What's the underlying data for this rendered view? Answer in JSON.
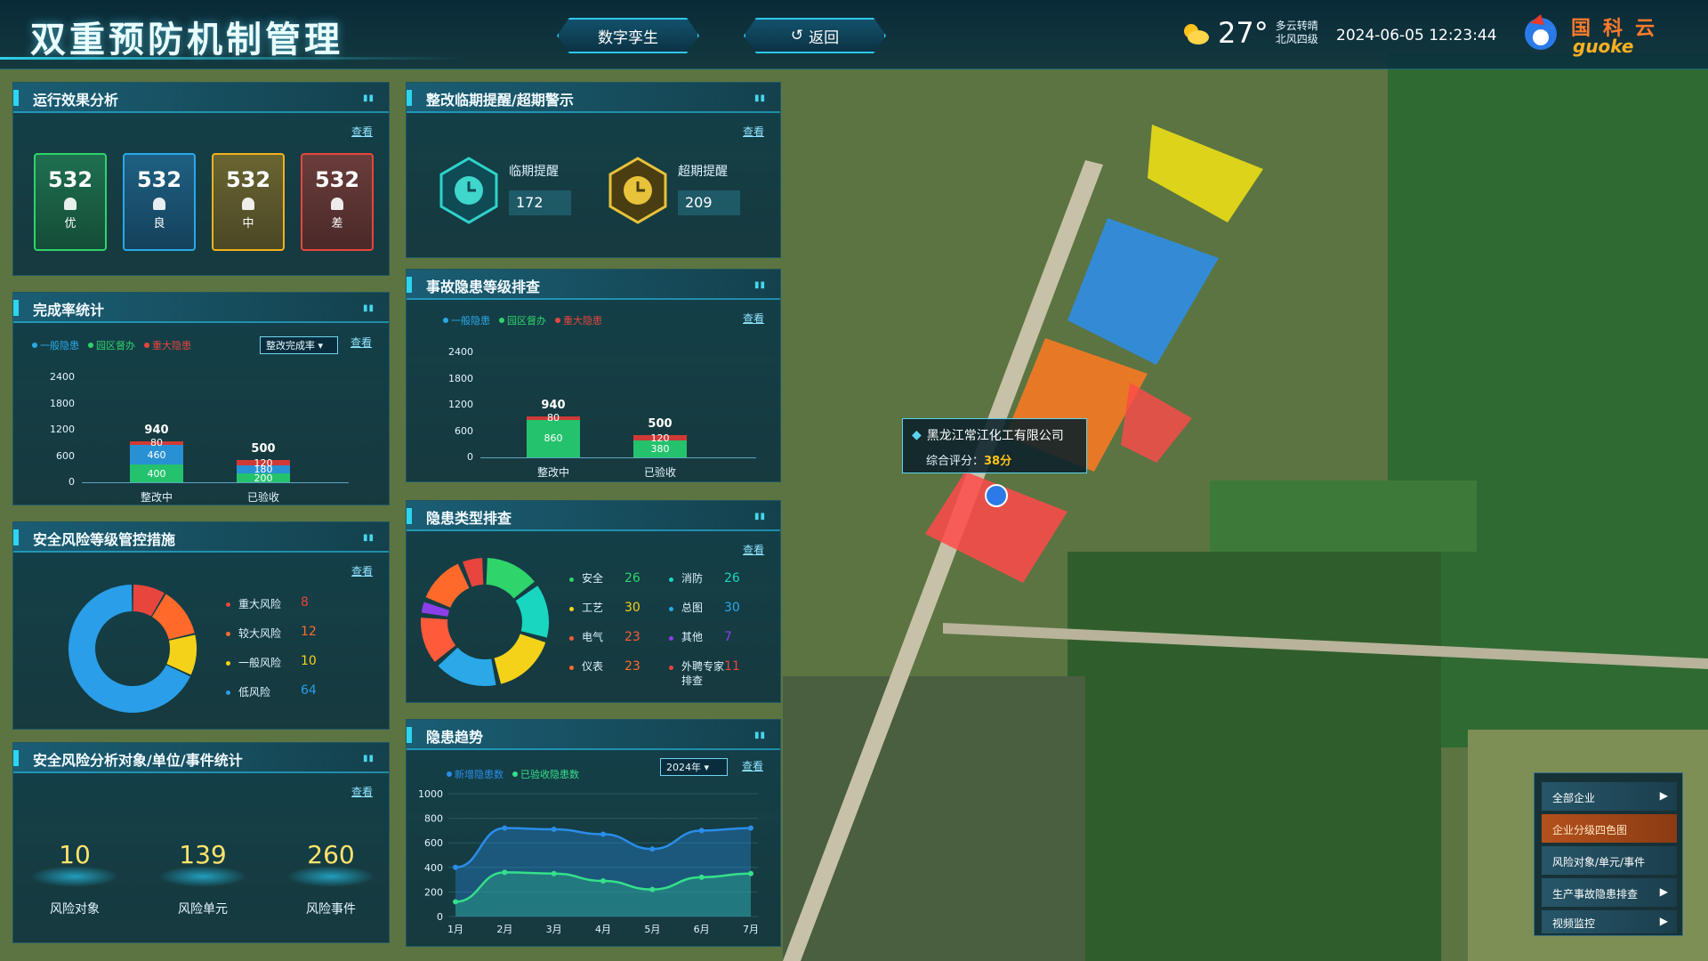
{
  "header": {
    "title": "双重预防机制管理",
    "nav_twin": "数字孪生",
    "nav_back": "返回",
    "temperature": "27°",
    "weather_line1": "多云转晴",
    "weather_line2": "北风四级",
    "datetime": "2024-06-05 12:23:44",
    "logo_cn": "国科云",
    "logo_en": "guoke"
  },
  "panels": {
    "effect": {
      "title": "运行效果分析",
      "view": "查看",
      "grades": [
        {
          "value": "532",
          "label": "优",
          "color": "#2fd46a"
        },
        {
          "value": "532",
          "label": "良",
          "color": "#2aa8e8"
        },
        {
          "value": "532",
          "label": "中",
          "color": "#f0b21e"
        },
        {
          "value": "532",
          "label": "差",
          "color": "#e8453c"
        }
      ]
    },
    "completion": {
      "title": "完成率统计",
      "view": "查看",
      "select": "整改完成率",
      "legend": [
        "一般隐患",
        "园区督办",
        "重大隐患"
      ],
      "yticks": [
        "2400",
        "1800",
        "1200",
        "600",
        "0"
      ]
    },
    "risk": {
      "title": "安全风险等级管控措施",
      "view": "查看",
      "items": [
        {
          "label": "重大风险",
          "value": "8"
        },
        {
          "label": "较大风险",
          "value": "12"
        },
        {
          "label": "一般风险",
          "value": "10"
        },
        {
          "label": "低风险",
          "value": "64"
        }
      ]
    },
    "objects": {
      "title": "安全风险分析对象/单位/事件统计",
      "view": "查看",
      "stats": [
        {
          "value": "10",
          "label": "风险对象"
        },
        {
          "value": "139",
          "label": "风险单元"
        },
        {
          "value": "260",
          "label": "风险事件"
        }
      ]
    },
    "rectify": {
      "title": "整改临期提醒/超期警示",
      "view": "查看",
      "near_label": "临期提醒",
      "near_value": "172",
      "over_label": "超期提醒",
      "over_value": "209"
    },
    "accident": {
      "title": "事故隐患等级排查",
      "view": "查看",
      "legend": [
        "一般隐患",
        "园区督办",
        "重大隐患"
      ],
      "yticks": [
        "2400",
        "1800",
        "1200",
        "600",
        "0"
      ]
    },
    "types": {
      "title": "隐患类型排查",
      "view": "查看",
      "items": [
        {
          "label": "安全",
          "value": "26"
        },
        {
          "label": "消防",
          "value": "26"
        },
        {
          "label": "工艺",
          "value": "30"
        },
        {
          "label": "总图",
          "value": "30"
        },
        {
          "label": "电气",
          "value": "23"
        },
        {
          "label": "其他",
          "value": "7"
        },
        {
          "label": "仪表",
          "value": "23"
        },
        {
          "label": "外聘专家排查",
          "value": "11"
        }
      ]
    },
    "trend": {
      "title": "隐患趋势",
      "view": "查看",
      "select": "2024年",
      "legend": [
        "新增隐患数",
        "已验收隐患数"
      ]
    }
  },
  "map": {
    "company": "黑龙江常江化工有限公司",
    "score_label": "综合评分：",
    "score": "38分"
  },
  "menu": [
    "全部企业",
    "企业分级四色图",
    "风险对象/单元/事件",
    "生产事故隐患排查",
    "视频监控"
  ],
  "chart_data": [
    {
      "type": "bar",
      "title": "完成率统计",
      "categories": [
        "整改中",
        "已验收"
      ],
      "series": [
        {
          "name": "一般隐患",
          "values": [
            400,
            200
          ],
          "color": "#25c26d"
        },
        {
          "name": "园区督办",
          "values": [
            460,
            180
          ],
          "color": "#2891d4"
        },
        {
          "name": "重大隐患",
          "values": [
            80,
            120
          ],
          "color": "#d03a36"
        }
      ],
      "totals": [
        940,
        500
      ],
      "ylim": [
        0,
        2400
      ]
    },
    {
      "type": "bar",
      "title": "事故隐患等级排查",
      "categories": [
        "整改中",
        "已验收"
      ],
      "series": [
        {
          "name": "园区督办",
          "values": [
            860,
            380
          ],
          "color": "#25c26d"
        },
        {
          "name": "重大隐患",
          "values": [
            80,
            120
          ],
          "color": "#d03a36"
        }
      ],
      "totals": [
        940,
        500
      ],
      "ylim": [
        0,
        2400
      ]
    },
    {
      "type": "pie",
      "title": "安全风险等级管控措施",
      "labels": [
        "重大风险",
        "较大风险",
        "一般风险",
        "低风险"
      ],
      "values": [
        8,
        12,
        10,
        64
      ],
      "colors": [
        "#e8453c",
        "#ff6a2a",
        "#f5d21a",
        "#2a9ee8"
      ]
    },
    {
      "type": "pie",
      "title": "隐患类型排查",
      "labels": [
        "安全",
        "消防",
        "工艺",
        "总图",
        "电气",
        "其他",
        "仪表",
        "外聘专家排查"
      ],
      "values": [
        26,
        26,
        30,
        30,
        23,
        7,
        23,
        11
      ],
      "colors": [
        "#2fd46a",
        "#19d6c0",
        "#f5d21a",
        "#2aa8e8",
        "#ff5a3a",
        "#8a3fe8",
        "#ff6a2a",
        "#e8453c"
      ]
    },
    {
      "type": "line",
      "title": "隐患趋势",
      "x": [
        "1月",
        "2月",
        "3月",
        "4月",
        "5月",
        "6月",
        "7月"
      ],
      "series": [
        {
          "name": "新增隐患数",
          "values": [
            400,
            720,
            710,
            670,
            550,
            700,
            720
          ],
          "color": "#2a8de8"
        },
        {
          "name": "已验收隐患数",
          "values": [
            120,
            360,
            350,
            290,
            220,
            320,
            350
          ],
          "color": "#35e08a"
        }
      ],
      "ylim": [
        0,
        1000
      ],
      "yticks": [
        1000,
        800,
        600,
        400,
        200,
        0
      ]
    }
  ]
}
